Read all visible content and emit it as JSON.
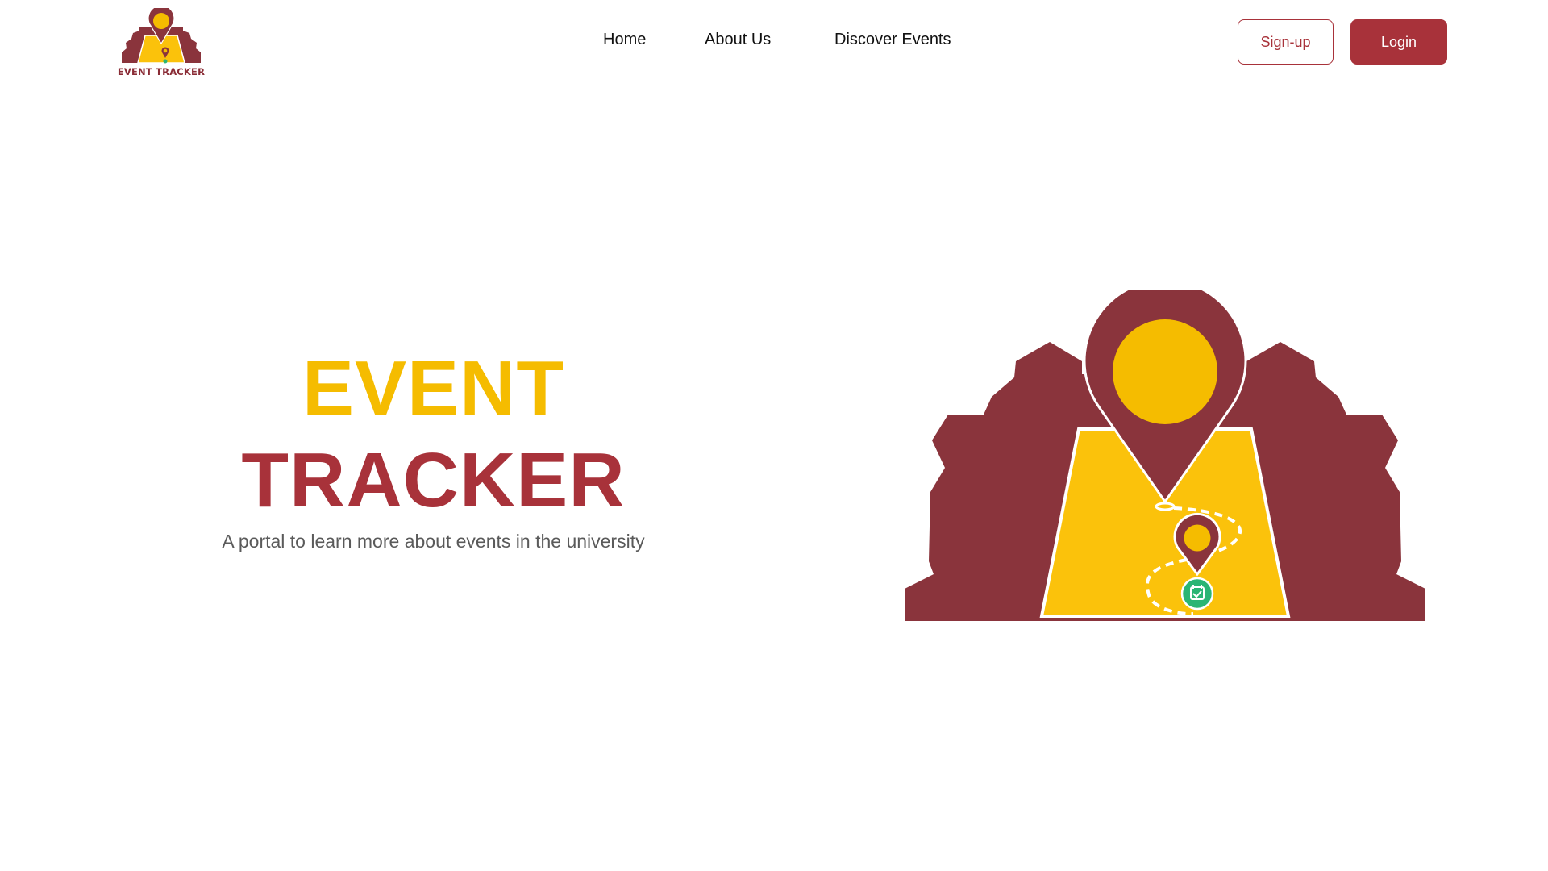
{
  "logo": {
    "text": "EVENT TRACKER"
  },
  "nav": {
    "home": "Home",
    "about": "About Us",
    "discover": "Discover Events"
  },
  "auth": {
    "signup_label": "Sign-up",
    "login_label": "Login"
  },
  "hero": {
    "title_line1": "EVENT",
    "title_line2": "TRACKER",
    "subtitle": "A portal to learn more about events in the university"
  },
  "colors": {
    "maroon": "#8a343c",
    "brand_red": "#a8323a",
    "yellow": "#f5bc00",
    "green": "#2bb574"
  }
}
